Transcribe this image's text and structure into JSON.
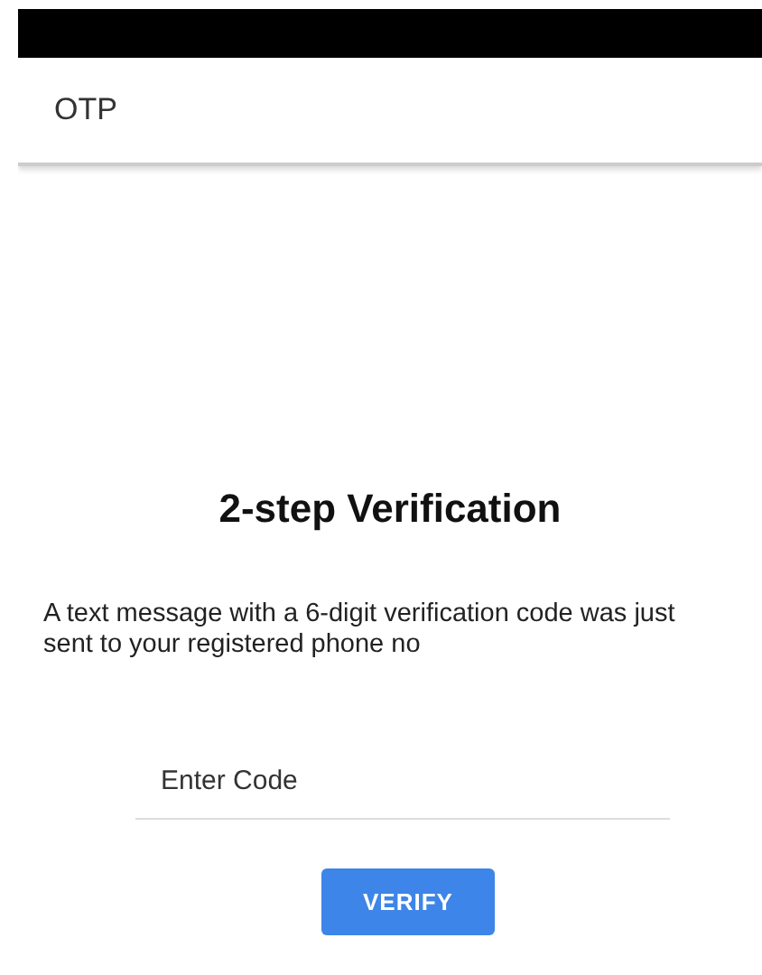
{
  "app_bar": {
    "title": "OTP"
  },
  "heading": "2-step Verification",
  "message": "A text message with a 6-digit verification code was just sent to your registered phone no",
  "code_field": {
    "placeholder": "Enter Code"
  },
  "verify_button": {
    "label": "VERIFY"
  }
}
